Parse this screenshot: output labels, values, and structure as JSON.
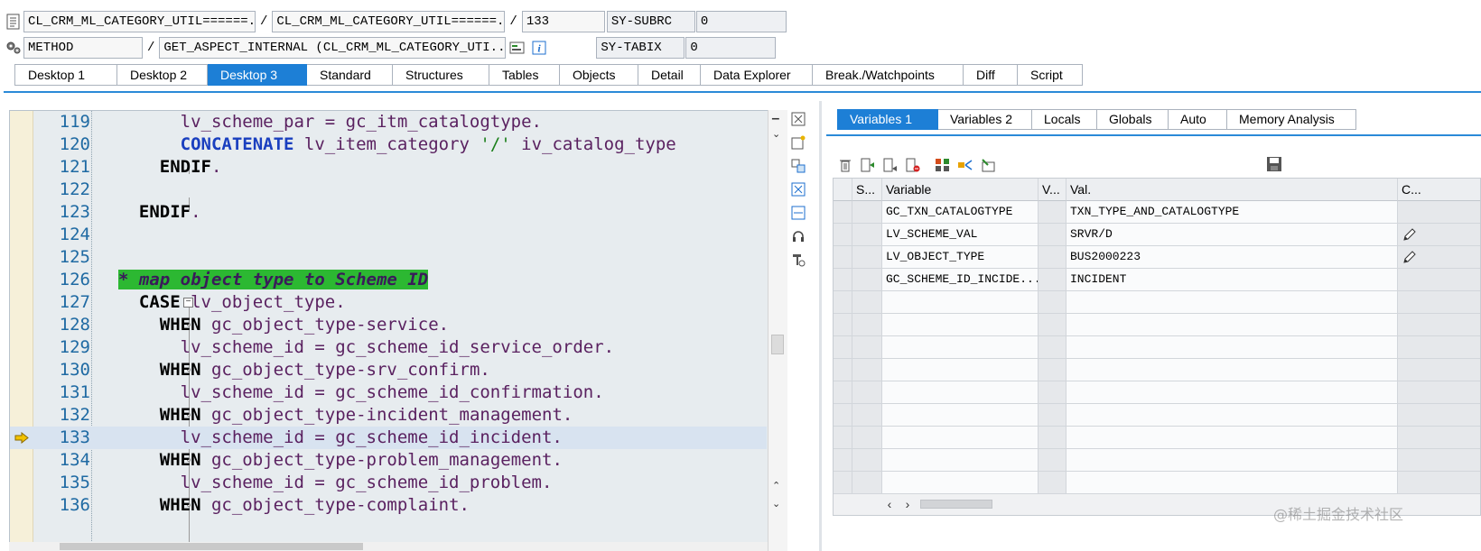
{
  "header": {
    "row1": {
      "program": "CL_CRM_ML_CATEGORY_UTIL======...",
      "include": "CL_CRM_ML_CATEGORY_UTIL======...",
      "line": "133",
      "sysfield_label": "SY-SUBRC",
      "sysfield_value": "0"
    },
    "row2": {
      "event_type": "METHOD",
      "event": "GET_ASPECT_INTERNAL (CL_CRM_ML_CATEGORY_UTI...",
      "sysfield_label": "SY-TABIX",
      "sysfield_value": "0"
    },
    "separator": "/"
  },
  "desktop_tabs": [
    {
      "label": "Desktop 1"
    },
    {
      "label": "Desktop 2"
    },
    {
      "label": "Desktop 3"
    },
    {
      "label": "Standard"
    },
    {
      "label": "Structures"
    },
    {
      "label": "Tables"
    },
    {
      "label": "Objects"
    },
    {
      "label": "Detail"
    },
    {
      "label": "Data Explorer"
    },
    {
      "label": "Break./Watchpoints"
    },
    {
      "label": "Diff"
    },
    {
      "label": "Script"
    }
  ],
  "active_desktop_tab": "Desktop 3",
  "code": {
    "current_line": "133",
    "lines": [
      {
        "n": "119",
        "a": "      lv_scheme_par = gc_itm_catalogtype."
      },
      {
        "n": "120",
        "a": "      ",
        "k": "CONCATENATE",
        "b": " lv_item_category ",
        "s": "'/'",
        "c": " iv_catalog_type"
      },
      {
        "n": "121",
        "a": "    ",
        "k": "ENDIF",
        "b": "."
      },
      {
        "n": "122",
        "a": ""
      },
      {
        "n": "123",
        "a": "  ",
        "k": "ENDIF",
        "b": "."
      },
      {
        "n": "124",
        "a": ""
      },
      {
        "n": "125",
        "a": ""
      },
      {
        "n": "126",
        "cmt": "* map object type to Scheme ID"
      },
      {
        "n": "127",
        "a": "  ",
        "k": "CASE",
        "b": " lv_object_type."
      },
      {
        "n": "128",
        "a": "    ",
        "k": "WHEN",
        "b": " gc_object_type-service."
      },
      {
        "n": "129",
        "a": "      lv_scheme_id = gc_scheme_id_service_order."
      },
      {
        "n": "130",
        "a": "    ",
        "k": "WHEN",
        "b": " gc_object_type-srv_confirm."
      },
      {
        "n": "131",
        "a": "      lv_scheme_id = gc_scheme_id_confirmation."
      },
      {
        "n": "132",
        "a": "    ",
        "k": "WHEN",
        "b": " gc_object_type-incident_management."
      },
      {
        "n": "133",
        "a": "      lv_scheme_id = gc_scheme_id_incident."
      },
      {
        "n": "134",
        "a": "    ",
        "k": "WHEN",
        "b": " gc_object_type-problem_management."
      },
      {
        "n": "135",
        "a": "      lv_scheme_id = gc_scheme_id_problem."
      },
      {
        "n": "136",
        "a": "    ",
        "k": "WHEN",
        "b": " gc_object_type-complaint."
      }
    ]
  },
  "variables_tabs": [
    {
      "label": "Variables 1"
    },
    {
      "label": "Variables 2"
    },
    {
      "label": "Locals"
    },
    {
      "label": "Globals"
    },
    {
      "label": "Auto"
    },
    {
      "label": "Memory Analysis"
    }
  ],
  "active_variables_tab": "Variables 1",
  "variables_grid": {
    "columns": [
      "S...",
      "Variable",
      "V...",
      "Val.",
      "C..."
    ],
    "rows": [
      {
        "variable": "GC_TXN_CATALOGTYPE",
        "value": "TXN_TYPE_AND_CATALOGTYPE",
        "editable": false
      },
      {
        "variable": "LV_SCHEME_VAL",
        "value": "SRVR/D",
        "editable": true
      },
      {
        "variable": "LV_OBJECT_TYPE",
        "value": "BUS2000223",
        "editable": true
      },
      {
        "variable": "GC_SCHEME_ID_INCIDE...",
        "value": "INCIDENT",
        "editable": false
      }
    ],
    "empty_rows": 9
  },
  "icons": {
    "header_row1": "document-icon",
    "header_row2": "gears-icon",
    "new_tool": "new-tool-icon",
    "info": "info-icon"
  },
  "watermark": "@稀土掘金技术社区",
  "colors": {
    "accent_blue": "#1d7fd6",
    "comment_highlight": "#2cb832",
    "current_line": "#d8e3f0",
    "breakpoint_gutter": "#f6f0d9"
  }
}
